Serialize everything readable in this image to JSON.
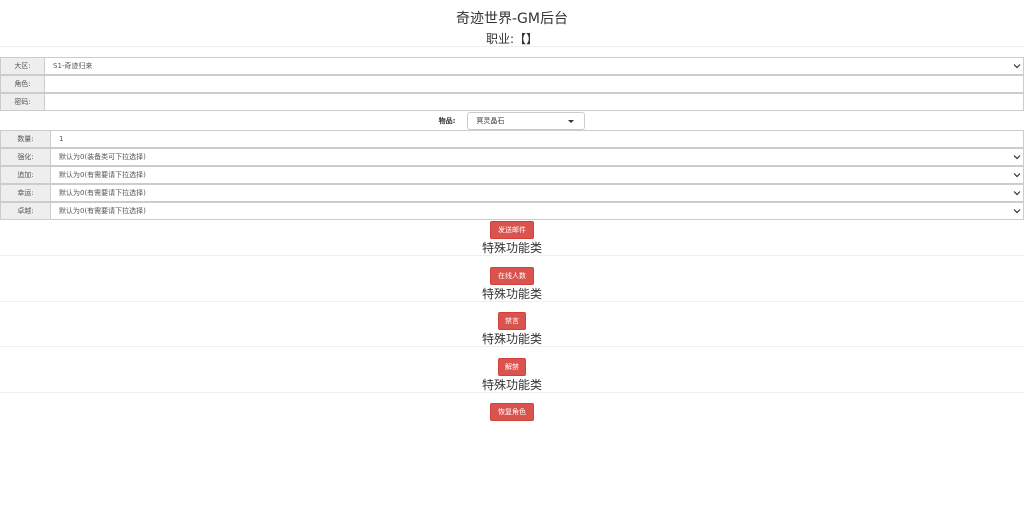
{
  "header": {
    "title": "奇迹世界-GM后台",
    "subtitle": "职业:【】"
  },
  "form1": {
    "region_label": "大区:",
    "region_value": "S1-奇迹归来",
    "role_label": "角色:",
    "role_value": "",
    "password_label": "密码:",
    "password_value": ""
  },
  "item": {
    "label": "物品:",
    "value": "冥灵晶石"
  },
  "form2": {
    "quantity_label": "数量:",
    "quantity_value": "1",
    "enhance_label": "强化:",
    "enhance_value": "默认为0(装备类可下拉选择)",
    "append_label": "追加:",
    "append_value": "默认为0(有需要请下拉选择)",
    "luck_label": "幸运:",
    "luck_value": "默认为0(有需要请下拉选择)",
    "excellent_label": "卓越:",
    "excellent_value": "默认为0(有需要请下拉选择)"
  },
  "actions": {
    "send_mail": "发送邮件",
    "section1": "特殊功能类",
    "online_count": "在线人数",
    "section2": "特殊功能类",
    "mute": "禁言",
    "section3": "特殊功能类",
    "unban": "解禁",
    "section4": "特殊功能类",
    "restore_role": "恢复角色"
  },
  "colors": {
    "danger_button": "#d9534f",
    "label_bg": "#eeeeee",
    "border": "#cccccc"
  }
}
